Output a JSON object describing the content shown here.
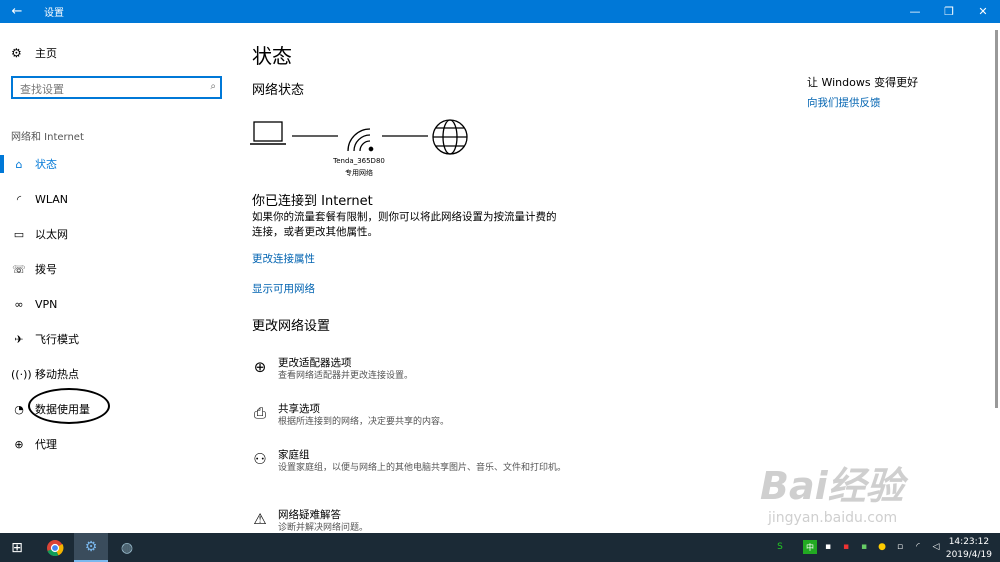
{
  "titlebar": {
    "title": "设置"
  },
  "sidebar": {
    "home": "主页",
    "search_placeholder": "查找设置",
    "section": "网络和 Internet",
    "items": [
      {
        "label": "状态",
        "icon": "home-icon",
        "selected": true
      },
      {
        "label": "WLAN",
        "icon": "wifi-icon"
      },
      {
        "label": "以太网",
        "icon": "ethernet-icon"
      },
      {
        "label": "拨号",
        "icon": "dialup-icon"
      },
      {
        "label": "VPN",
        "icon": "vpn-icon"
      },
      {
        "label": "飞行模式",
        "icon": "airplane-icon"
      },
      {
        "label": "移动热点",
        "icon": "hotspot-icon"
      },
      {
        "label": "数据使用量",
        "icon": "data-usage-icon"
      },
      {
        "label": "代理",
        "icon": "globe-icon"
      }
    ]
  },
  "main": {
    "title": "状态",
    "network_status": "网络状态",
    "network_name": "Tenda_365D80",
    "network_type": "专用网络",
    "connected": "你已连接到 Internet",
    "desc": "如果你的流量套餐有限制，则你可以将此网络设置为按流量计费的连接，或者更改其他属性。",
    "link1": "更改连接属性",
    "link2": "显示可用网络",
    "change_settings": "更改网络设置",
    "options": [
      {
        "title": "更改适配器选项",
        "desc": "查看网络适配器并更改连接设置。"
      },
      {
        "title": "共享选项",
        "desc": "根据所连接到的网络，决定要共享的内容。"
      },
      {
        "title": "家庭组",
        "desc": "设置家庭组，以便与网络上的其他电脑共享图片、音乐、文件和打印机。"
      },
      {
        "title": "网络疑难解答",
        "desc": "诊断并解决网络问题。"
      }
    ]
  },
  "right": {
    "improve": "让 Windows 变得更好",
    "feedback": "向我们提供反馈"
  },
  "taskbar": {
    "time": "14:23:12",
    "date": "2019/4/19"
  },
  "watermark": {
    "brand": "Bai经验",
    "url": "jingyan.baidu.com"
  },
  "colors": {
    "accent": "#0078d7",
    "link": "#0063b1",
    "taskbar": "#1b2a36"
  }
}
